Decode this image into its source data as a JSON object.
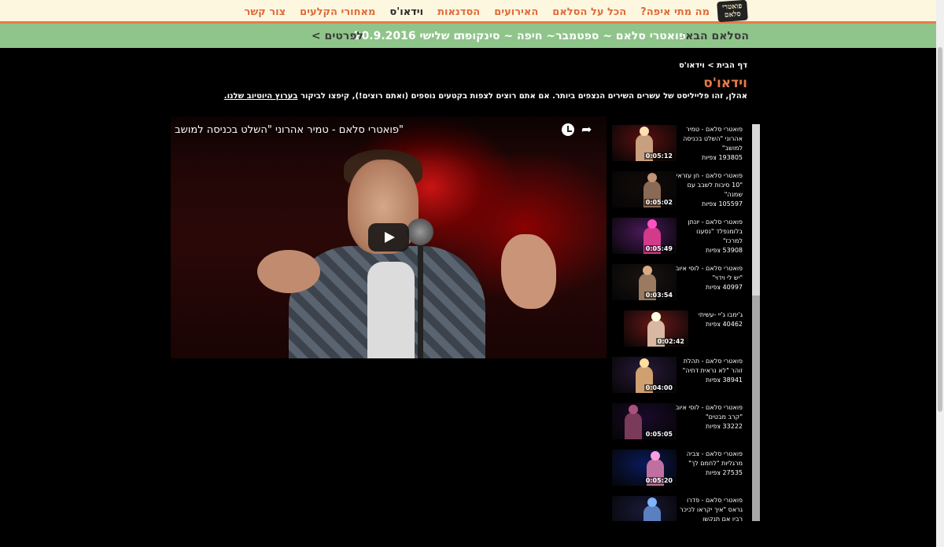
{
  "nav": {
    "logo_line1": "פואטרי",
    "logo_line2": "סלאם",
    "items": [
      {
        "label": "מה מתי איפה?",
        "active": false
      },
      {
        "label": "הכל על הסלאם",
        "active": false
      },
      {
        "label": "האירועים",
        "active": false
      },
      {
        "label": "הסדנאות",
        "active": false
      },
      {
        "label": "וידאו'ס",
        "active": true
      },
      {
        "label": "מאחורי הקלעים",
        "active": false
      },
      {
        "label": "צור קשר",
        "active": false
      }
    ]
  },
  "announce": {
    "label": "הסלאם הבא:",
    "text": "פואטרי סלאם ~ ספטמבר~ חיפה ~ סינקופה",
    "date": "יום שלישי 20.9.2016",
    "more": "לפרטים >"
  },
  "breadcrumb": "דף הבית > וידאו'ס",
  "page_title": "וידאו'ס",
  "intro": {
    "text": "אהלן, זהו פלייליסט של עשרים השירים הנצפים ביותר. אם אתם רוצים לצפות בקטעים נוספים (ואתם רוצים!), קיפצו לביקור",
    "link": "בערוץ היוטיוב שלנו."
  },
  "player": {
    "title": "\"פואטרי סלאם - טמיר אהרוני \"השלט בכניסה למושב",
    "share_icon": "share-icon",
    "watch_later_icon": "clock-icon",
    "play_icon": "play-icon"
  },
  "playlist": [
    {
      "title": "פואטרי סלאם - טמיר אהרוני \"השלט בכניסה למושב\"",
      "views": "193805 צפיות",
      "duration": "0:05:12",
      "bg": "#5a1010",
      "fig": "#c8a080"
    },
    {
      "title": "פואטרי סלאם - חן עזראי \"10 סיבות לשבב עם שמנה\"",
      "views": "105597 צפיות",
      "duration": "0:05:02",
      "bg": "#120c0a",
      "fig": "#8a6a55"
    },
    {
      "title": "פואטרי סלאם - יונתן בלומנפלד \"נסענו למרכז\"",
      "views": "53908 צפיות",
      "duration": "0:05:49",
      "bg": "#4a1a5a",
      "fig": "#d23a8a"
    },
    {
      "title": "פואטרי סלאם - לוסי איוב \"יש לי וידוי\"",
      "views": "40997 צפיות",
      "duration": "0:03:54",
      "bg": "#1a1412",
      "fig": "#9a7a60"
    },
    {
      "title": "ג'ימבו ג'יי -עשיתי",
      "views": "40462 צפיות",
      "duration": "0:02:42",
      "bg": "#6a1818",
      "fig": "#d8b8a0"
    },
    {
      "title": "פואטרי סלאם - תהלת זוהר \"לא נראית דתיה\"",
      "views": "38941 צפיות",
      "duration": "0:04:00",
      "bg": "#2a1a3a",
      "fig": "#d0a070"
    },
    {
      "title": "פואטרי סלאם - לוסי איוב \"קרב מבטים\"",
      "views": "33222 צפיות",
      "duration": "0:05:05",
      "bg": "#1a0a2a",
      "fig": "#7a3a5a"
    },
    {
      "title": "פואטרי סלאם - צביה מרגליות \"לחמם לך\"",
      "views": "27535 צפיות",
      "duration": "0:05:20",
      "bg": "#0a1a5a",
      "fig": "#c070a0"
    },
    {
      "title": "פואטרי סלאם - פדרו גראס \"איך יקראו לכיכר רבין אם תנקשו",
      "views": "",
      "duration": "",
      "bg": "#1a1a3a",
      "fig": "#5a80c0"
    }
  ]
}
